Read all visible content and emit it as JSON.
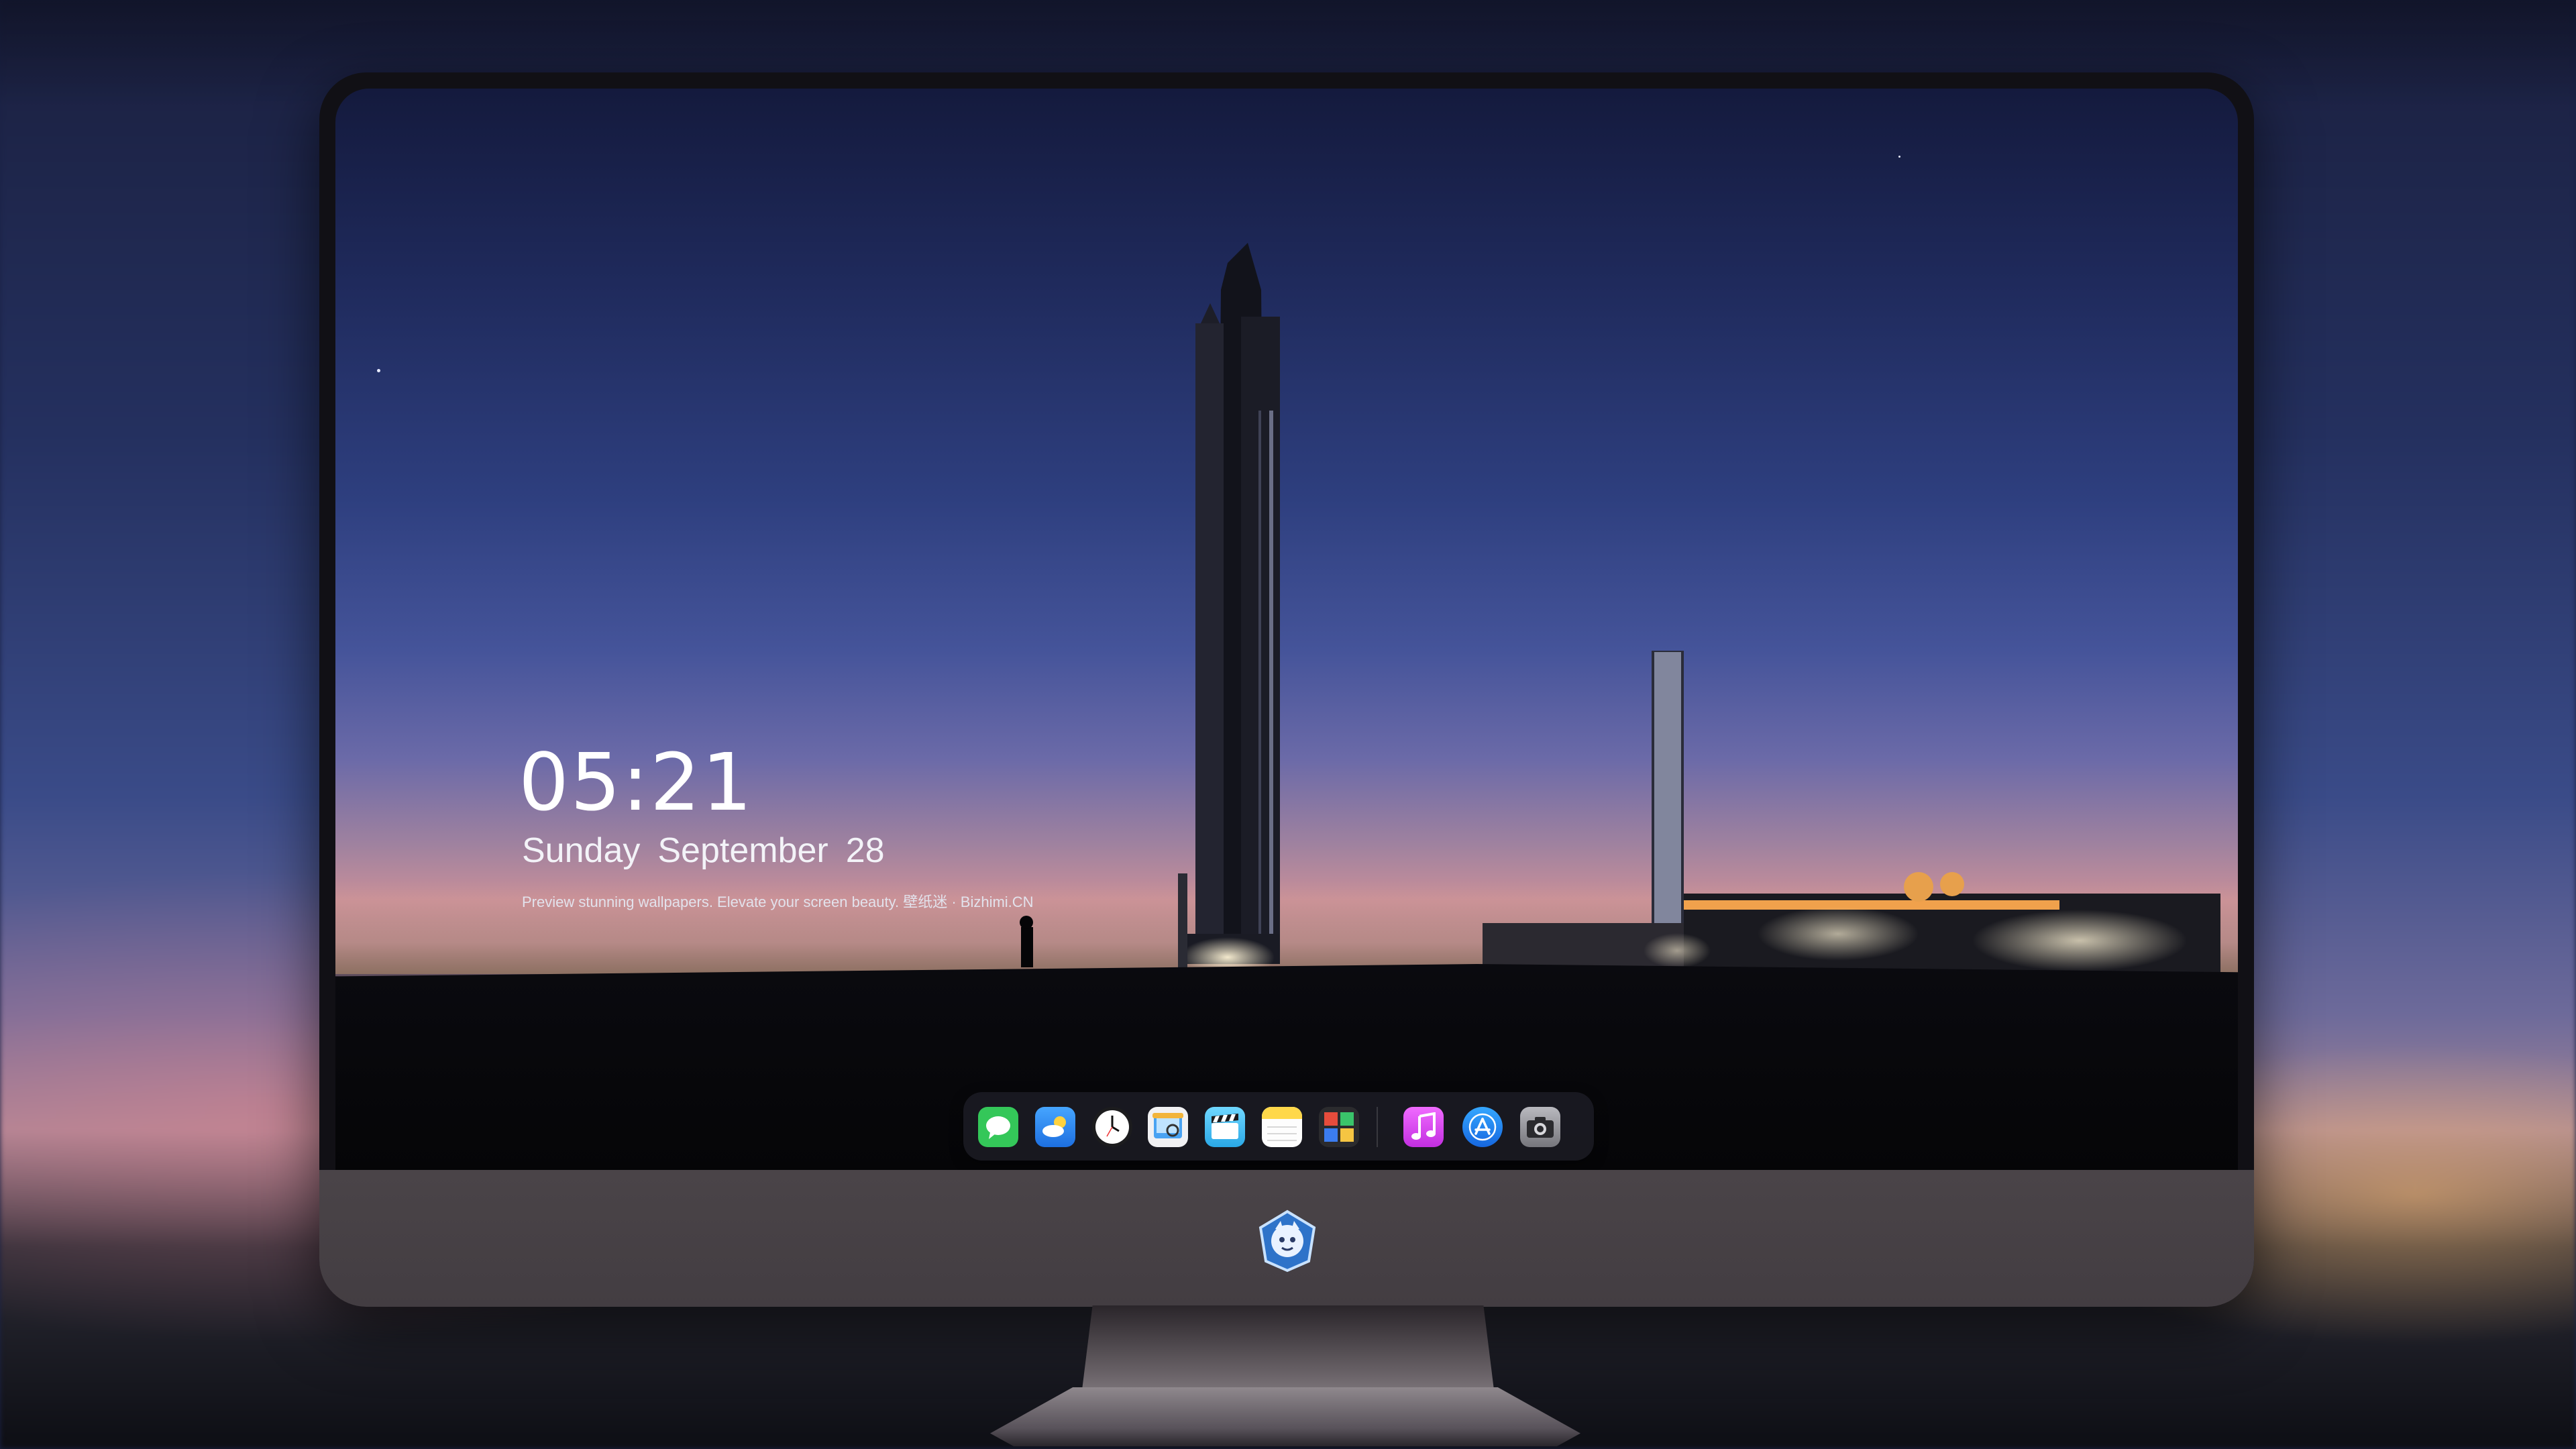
{
  "lock_screen": {
    "time": "05:21",
    "weekday": "Sunday",
    "month": "September",
    "day": "28",
    "caption": "Preview stunning wallpapers. Elevate your screen beauty. 壁纸迷 · Bizhimi.CN"
  },
  "dock": {
    "apps": [
      {
        "name": "messages",
        "icon": "messages-icon",
        "color": "#34c759"
      },
      {
        "name": "weather",
        "icon": "weather-icon",
        "color": "#2f8cf0"
      },
      {
        "name": "clock",
        "icon": "clock-icon",
        "color": "#ffffff"
      },
      {
        "name": "preview",
        "icon": "preview-icon",
        "color": "#f2b43a"
      },
      {
        "name": "clips",
        "icon": "clapperboard-icon",
        "color": "#5ac8fa"
      },
      {
        "name": "notes",
        "icon": "notes-icon",
        "color": "#ffd84a"
      },
      {
        "name": "photo-booth",
        "icon": "photo-booth-icon",
        "color": "#e74c3c"
      },
      {
        "name": "music",
        "icon": "music-note-icon",
        "color": "#d83ff0"
      },
      {
        "name": "app-store",
        "icon": "app-store-icon",
        "color": "#1e7cf2"
      },
      {
        "name": "camera",
        "icon": "camera-icon",
        "color": "#7d7d83"
      }
    ]
  },
  "monitor": {
    "logo_icon": "mascot-logo-icon"
  }
}
